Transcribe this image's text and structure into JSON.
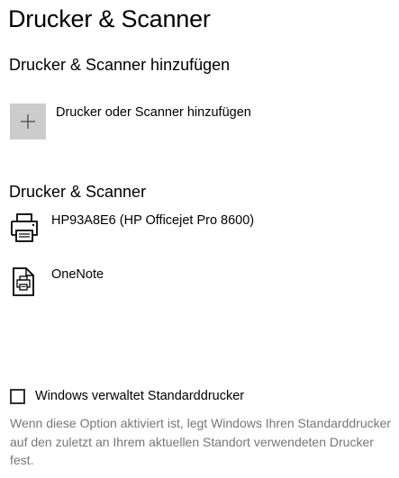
{
  "page": {
    "title": "Drucker & Scanner"
  },
  "add_section": {
    "heading": "Drucker & Scanner hinzufügen",
    "add_button_label": "Drucker oder Scanner hinzufügen",
    "add_icon": "plus-icon"
  },
  "devices_section": {
    "heading": "Drucker & Scanner",
    "devices": [
      {
        "name": "HP93A8E6 (HP Officejet Pro 8600)",
        "icon": "printer-icon"
      },
      {
        "name": "OneNote",
        "icon": "document-printer-icon"
      }
    ]
  },
  "default_printer": {
    "checkbox_label": "Windows verwaltet Standarddrucker",
    "checked": false,
    "description": "Wenn diese Option aktiviert ist, legt Windows Ihren Standarddrucker auf den zuletzt an Ihrem aktuellen Standort verwendeten Drucker fest."
  },
  "colors": {
    "add_tile_background": "#cccccc",
    "description_text": "#767676"
  }
}
